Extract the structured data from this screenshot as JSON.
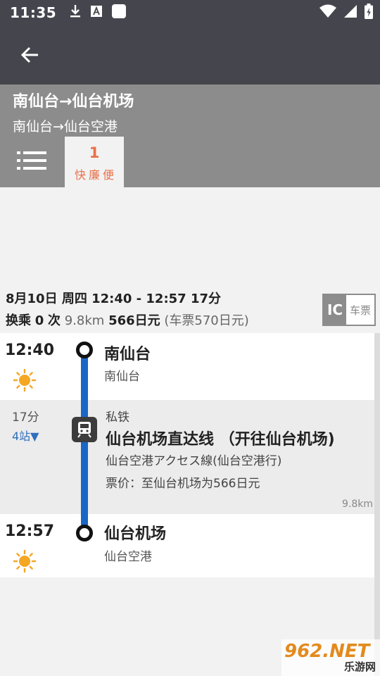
{
  "status_bar": {
    "time": "11:35",
    "icons_left": [
      "download-icon",
      "a-icon",
      "square-icon"
    ],
    "icons_right": [
      "wifi-icon",
      "cell-signal-icon",
      "battery-icon"
    ]
  },
  "top_bar": {
    "back_icon": "back-arrow-icon"
  },
  "route_header": {
    "title": "南仙台→仙台机场",
    "subtitle": "南仙台→仙台空港",
    "tab": {
      "number": "1",
      "tags": "快廉便"
    }
  },
  "summary": {
    "date_time": "8月10日 周四 12:40 - 12:57 17分",
    "transfers_prefix": "换乘",
    "transfers_count": "0",
    "transfers_suffix": "次",
    "distance": "9.8km",
    "fare": "566日元",
    "ticket_fare": "(车票570日元)",
    "ic_label": "IC",
    "ticket_label": "车票"
  },
  "departure": {
    "time": "12:40",
    "weather_icon": "sun-icon",
    "station": "南仙台",
    "station_sub": "南仙台"
  },
  "segment": {
    "duration": "17分",
    "stops": "4站▼",
    "type": "私铁",
    "line": "仙台机场直达线 （开往仙台机场)",
    "direction": "仙台空港アクセス線(仙台空港行)",
    "fare": "票价：至仙台机场为566日元",
    "distance": "9.8km",
    "icon": "train-icon"
  },
  "arrival": {
    "time": "12:57",
    "weather_icon": "sun-icon",
    "station": "仙台机场",
    "station_sub": "仙台空港"
  },
  "colors": {
    "header_dark": "#45454d",
    "header_gray": "#8c8c8c",
    "accent_orange": "#e8714a",
    "timeline_blue": "#1a66c7",
    "stops_blue": "#2e6fbf",
    "sun_orange": "#f5a623"
  },
  "watermark": {
    "main": "962.NET",
    "sub": "乐游网"
  }
}
